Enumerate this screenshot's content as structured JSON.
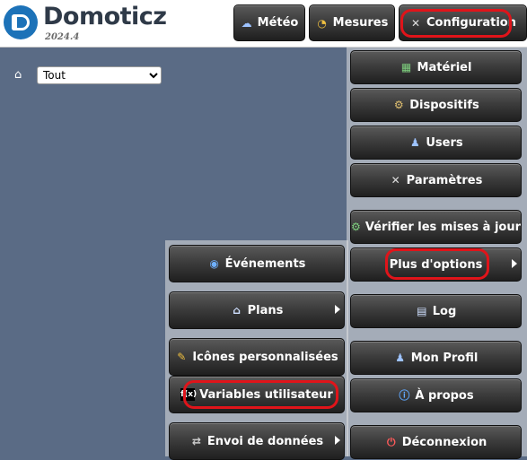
{
  "brand": {
    "name": "Domoticz",
    "version": "2024.4"
  },
  "topnav": {
    "meteo": "Météo",
    "mesures": "Mesures",
    "configuration": "Configuration"
  },
  "filter": {
    "selected": "Tout"
  },
  "config_menu": {
    "materiel": "Matériel",
    "dispositifs": "Dispositifs",
    "users": "Users",
    "parametres": "Paramètres",
    "verifier": "Vérifier les mises à jour",
    "plus_options": "Plus d'options",
    "log": "Log",
    "mon_profil": "Mon Profil",
    "a_propos": "À propos",
    "deconnexion": "Déconnexion"
  },
  "options_submenu": {
    "evenements": "Événements",
    "plans": "Plans",
    "icones": "Icônes personnalisées",
    "variables": "Variables utilisateur",
    "envoi": "Envoi de données"
  },
  "colors": {
    "highlight": "#e0141a",
    "background": "#5a6b85"
  }
}
